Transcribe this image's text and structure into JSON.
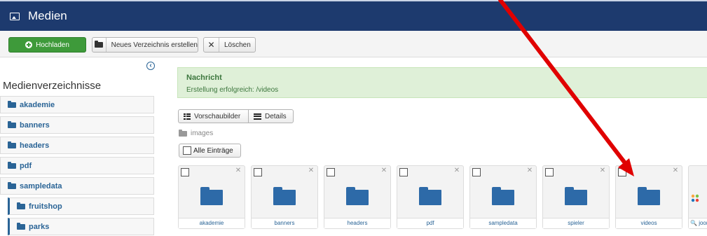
{
  "header": {
    "title": "Medien"
  },
  "toolbar": {
    "upload_label": "Hochladen",
    "new_dir_label": "Neues Verzeichnis erstellen",
    "delete_label": "Löschen"
  },
  "sidebar": {
    "title": "Medienverzeichnisse",
    "items": [
      {
        "label": "akademie"
      },
      {
        "label": "banners"
      },
      {
        "label": "headers"
      },
      {
        "label": "pdf"
      },
      {
        "label": "sampledata"
      },
      {
        "label": "fruitshop"
      },
      {
        "label": "parks"
      }
    ]
  },
  "alert": {
    "title": "Nachricht",
    "message": "Erstellung erfolgreich: /videos"
  },
  "view": {
    "thumbnails_label": "Vorschaubilder",
    "details_label": "Details"
  },
  "breadcrumb": {
    "label": "images"
  },
  "select_all_label": "Alle Einträge",
  "folders": [
    {
      "name": "akademie"
    },
    {
      "name": "banners"
    },
    {
      "name": "headers"
    },
    {
      "name": "pdf"
    },
    {
      "name": "sampledata"
    },
    {
      "name": "spieler"
    },
    {
      "name": "videos"
    }
  ],
  "partial_item": {
    "name": "joom"
  },
  "colors": {
    "header_bg": "#1d3a6e",
    "upload_green": "#3e9a3a",
    "link_blue": "#2a6496",
    "folder_blue": "#2d6aa8",
    "alert_bg": "#dff0d8",
    "annotation_arrow": "#e00000"
  }
}
